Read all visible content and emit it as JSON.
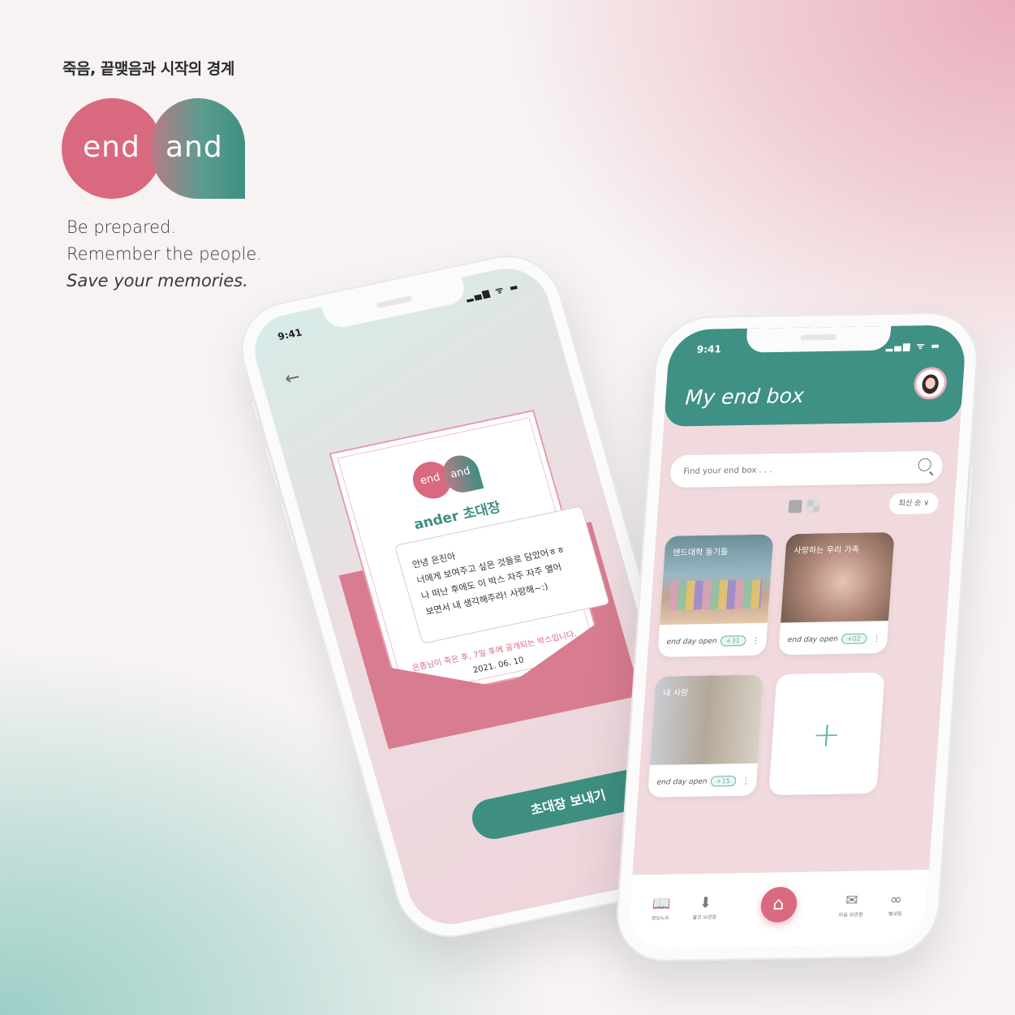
{
  "brand": {
    "tagline_ko": "죽음, 끝맺음과 시작의 경계",
    "logo_left": "end",
    "logo_right": "and",
    "slogan": [
      "Be prepared.",
      "Remember the people.",
      "Save your memories."
    ],
    "colors": {
      "pink": "#d9697f",
      "teal": "#3e8f82"
    }
  },
  "invite_screen": {
    "time": "9:41",
    "status_icons": "signal wifi battery",
    "back_icon": "arrow-left-icon",
    "mini_logo_left": "end",
    "mini_logo_right": "and",
    "card_title": "ander 초대장",
    "message_lines": [
      "안녕 은진아",
      "너에게 보여주고 싶은 것들로 담았어ㅎㅎ",
      "나 떠난 후에도 이 박스 자주  자주 열어",
      "보면서 내 생각해주라! 사랑해~:)"
    ],
    "notice": "은종님이 죽은 후, 7일 후에 공개되는 박스입니다.",
    "date": "2021. 06. 10",
    "send_button": "초대장 보내기"
  },
  "box_screen": {
    "time": "9:41",
    "title": "My end box",
    "search_placeholder": "Find your end box . . .",
    "sort_label": "최신 순 ∨",
    "tiles": [
      {
        "caption": "앤드대학 동기들",
        "footer": "end day open",
        "badge": "+31"
      },
      {
        "caption": "사랑하는 우리 가족",
        "footer": "end day open",
        "badge": "+02"
      },
      {
        "caption": "내 사랑",
        "footer": "end day open",
        "badge": "+15"
      }
    ],
    "add_symbol": "+",
    "more_symbol": "⋮",
    "nav": [
      {
        "icon": "book-icon",
        "glyph": "📖",
        "label": "엔딩노트"
      },
      {
        "icon": "download-box-icon",
        "glyph": "⬇",
        "label": "물건 보관함"
      },
      {
        "icon": "home-icon",
        "glyph": "⌂",
        "label": ""
      },
      {
        "icon": "mail-icon",
        "glyph": "✉",
        "label": "마음 보관함"
      },
      {
        "icon": "infinity-icon",
        "glyph": "∞",
        "label": "별내림"
      }
    ]
  }
}
